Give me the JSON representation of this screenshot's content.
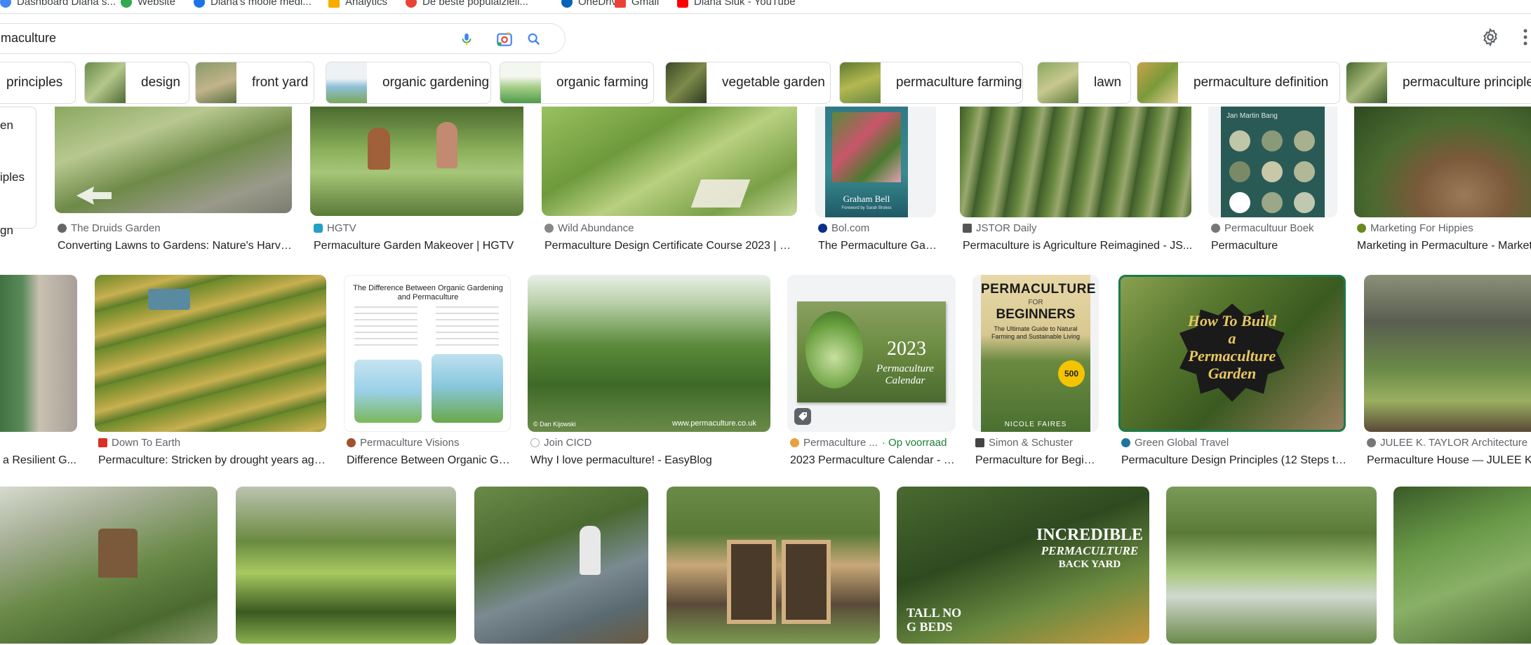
{
  "bookmarks": [
    "Dashboard Diana s...",
    "Website",
    "Diana's mooie medi...",
    "Analytics",
    "De beste populaiziell...",
    "OneDrive",
    "Gmail",
    "Diana Sluk - YouTube"
  ],
  "search": {
    "value": "maculture"
  },
  "icons": {
    "mic": "mic-icon",
    "camera": "camera-search-icon",
    "search": "search-icon",
    "settings": "gear-icon",
    "more": "more-vert-icon",
    "badge": "tag-icon"
  },
  "chips": [
    {
      "label": "principles"
    },
    {
      "label": "design"
    },
    {
      "label": "front yard"
    },
    {
      "label": "organic gardening"
    },
    {
      "label": "organic farming"
    },
    {
      "label": "vegetable garden"
    },
    {
      "label": "permaculture farming"
    },
    {
      "label": "lawn"
    },
    {
      "label": "permaculture definition"
    },
    {
      "label": "permaculture principles"
    }
  ],
  "sidebar": {
    "items": [
      "en",
      "iples",
      "gn"
    ]
  },
  "row1": [
    {
      "source": "The Druids Garden",
      "title": "Converting Lawns to Gardens: Nature's Harves..."
    },
    {
      "source": "HGTV",
      "title": "Permaculture Garden Makeover | HGTV"
    },
    {
      "source": "Wild Abundance",
      "title": "Permaculture Design Certificate Course 2023 | Wil..."
    },
    {
      "source": "Bol.com",
      "title": "The Permaculture Gard...",
      "cover_title": "Graham Bell",
      "cover_sub": "Foreword by Sarah Brokes"
    },
    {
      "source": "JSTOR Daily",
      "title": "Permaculture is Agriculture Reimagined - JS..."
    },
    {
      "source": "Permacultuur Boek",
      "title": "Permaculture",
      "cover_author": "Jan Martin Bang"
    },
    {
      "source": "Marketing For Hippies",
      "title": "Marketing in Permaculture - Marketi..."
    }
  ],
  "row2": [
    {
      "source": "",
      "title": "a Resilient G..."
    },
    {
      "source": "Down To Earth",
      "title": "Permaculture: Stricken by drought years ago,..."
    },
    {
      "source": "Permaculture Visions",
      "title": "Difference Between Organic Ga...",
      "img_title": "The Difference Between Organic Gardening and Permaculture"
    },
    {
      "source": "Join CICD",
      "title": "Why I love permaculture! - EasyBlog",
      "img_credit": "© Dan Kijowski",
      "img_url": "www.permaculture.co.uk"
    },
    {
      "source": "Permaculture ...",
      "stock": "· Op voorraad",
      "title": "2023 Permaculture Calendar - a...",
      "img_year": "2023",
      "img_text": "Permaculture Calendar"
    },
    {
      "source": "Simon & Schuster",
      "title": "Permaculture for Begin...",
      "img_title": "PERMACULTURE",
      "img_for": "FOR",
      "img_title2": "BEGINNERS",
      "img_sub": "The Ultimate Guide to Natural Farming and Sustainable Living",
      "img_badge": "500",
      "img_author": "NICOLE FAIRES"
    },
    {
      "source": "Green Global Travel",
      "title": "Permaculture Design Principles (12 Steps to...",
      "img_text": "How To Build a Permaculture Garden"
    },
    {
      "source": "JULEE K. TAYLOR Architecture",
      "title": "Permaculture House — JULEE K. T..."
    }
  ],
  "row3": [
    {
      "img_text": ""
    },
    {
      "img_text": ""
    },
    {
      "img_text": ""
    },
    {
      "img_text": ""
    },
    {
      "img_text1": "INCREDIBLE",
      "img_text2": "PERMACULTURE",
      "img_text3": "BACK YARD",
      "img_text4": "TALL NO",
      "img_text5": "G BEDS"
    },
    {
      "img_text": ""
    },
    {
      "img_text": ""
    }
  ]
}
